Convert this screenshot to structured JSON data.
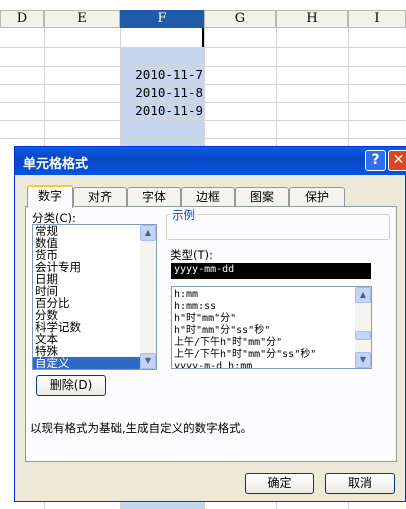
{
  "sheet": {
    "columns": [
      "D",
      "E",
      "F",
      "G",
      "H",
      "I"
    ],
    "selected_column": "F",
    "cells": [
      "2010-11-7",
      "2010-11-8",
      "2010-11-9"
    ]
  },
  "dialog": {
    "title": "单元格格式",
    "help_glyph": "?",
    "close_glyph": "✕",
    "tabs": [
      "数字",
      "对齐",
      "字体",
      "边框",
      "图案",
      "保护"
    ],
    "active_tab": "数字",
    "category_label": "分类(C):",
    "categories": [
      "常规",
      "数值",
      "货币",
      "会计专用",
      "日期",
      "时间",
      "百分比",
      "分数",
      "科学记数",
      "文本",
      "特殊",
      "自定义"
    ],
    "selected_category": "自定义",
    "sample_label": "示例",
    "type_label": "类型(T):",
    "type_value": "yyyy-mm-dd",
    "type_list": [
      "h:mm",
      "h:mm:ss",
      "h\"时\"mm\"分\"",
      "h\"时\"mm\"分\"ss\"秒\"",
      "上午/下午h\"时\"mm\"分\"",
      "上午/下午h\"时\"mm\"分\"ss\"秒\"",
      "yyyy-m-d h:mm"
    ],
    "delete_button": "删除(D)",
    "description": "以现有格式为基础,生成自定义的数字格式。",
    "ok_button": "确定",
    "cancel_button": "取消"
  },
  "colors": {
    "title_bar": "#0747c2",
    "selection": "#316ac5",
    "column_highlight": "#c6d6ef"
  }
}
